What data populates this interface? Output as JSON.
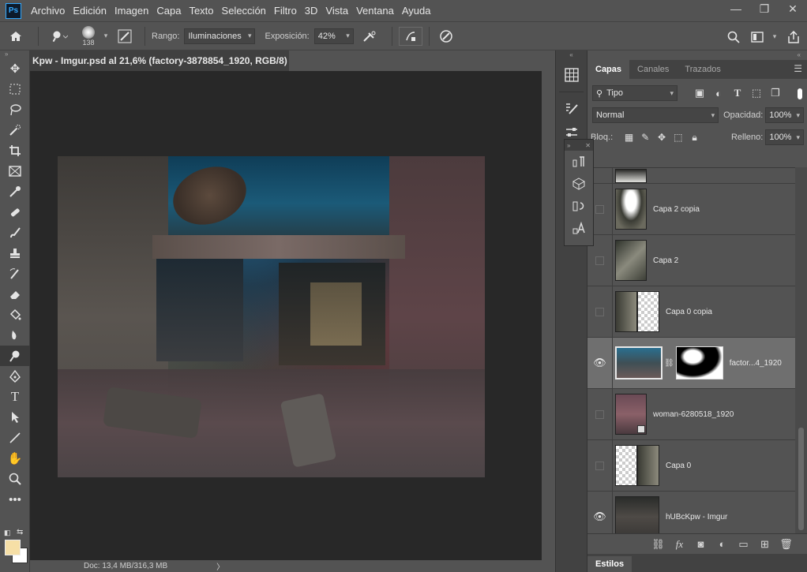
{
  "app": {
    "logo": "Ps"
  },
  "menu": [
    "Archivo",
    "Edición",
    "Imagen",
    "Capa",
    "Texto",
    "Selección",
    "Filtro",
    "3D",
    "Vista",
    "Ventana",
    "Ayuda"
  ],
  "window_controls": {
    "minimize": "—",
    "restore": "❐",
    "close": "✕"
  },
  "options": {
    "brush_size": "138",
    "range_label": "Rango:",
    "range_value": "Iluminaciones",
    "exposure_label": "Exposición:",
    "exposure_value": "42%"
  },
  "document": {
    "tab_title": "Kpw - Imgur.psd al 21,6% (factory-3878854_1920, RGB/8) *",
    "tab_close": "×",
    "status": "Doc: 13,4 MB/316,3 MB",
    "status_arrow": "〉"
  },
  "panel": {
    "tabs": [
      "Capas",
      "Canales",
      "Trazados"
    ],
    "filter_value": "Tipo",
    "blend_mode": "Normal",
    "opacity_label": "Opacidad:",
    "opacity_value": "100%",
    "lock_label": "Bloq.:",
    "fill_label": "Relleno:",
    "fill_value": "100%",
    "bottom_tab": "Estilos"
  },
  "layers": [
    {
      "name": "Capa 2 copia",
      "visible": false
    },
    {
      "name": "Capa 2",
      "visible": false
    },
    {
      "name": "Capa 0 copia",
      "visible": false
    },
    {
      "name": "factor...4_1920",
      "visible": true,
      "selected": true
    },
    {
      "name": "woman-6280518_1920",
      "visible": false
    },
    {
      "name": "Capa 0",
      "visible": false
    },
    {
      "name": "hUBcKpw - Imgur",
      "visible": true
    }
  ],
  "colors": {
    "foreground": "#f6dfa6",
    "background": "#ffffff",
    "accent": "#31a8ff"
  }
}
